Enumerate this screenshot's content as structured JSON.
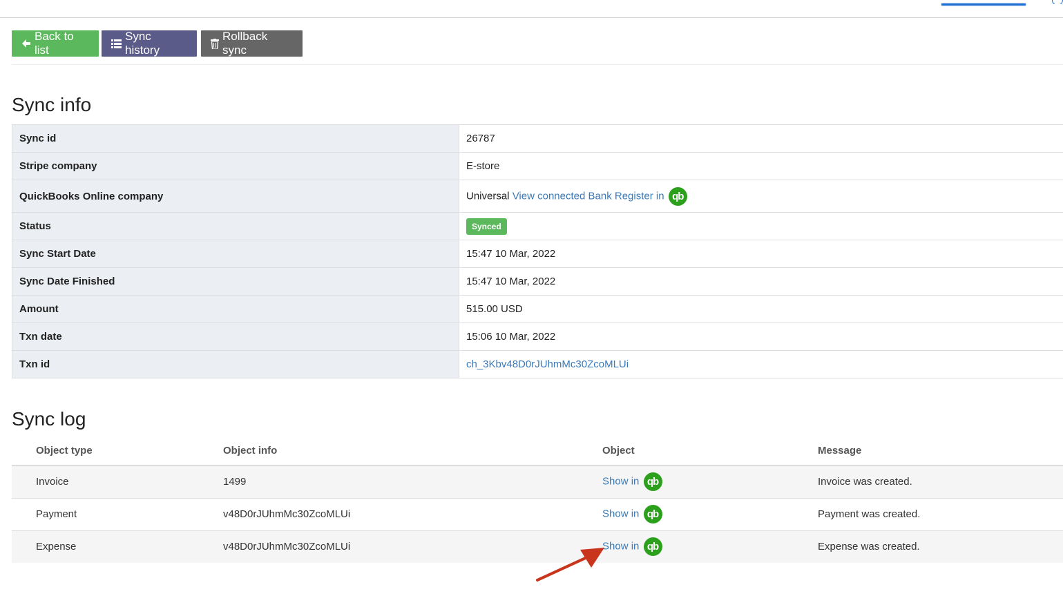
{
  "toolbar": {
    "back_label": "Back to list",
    "history_label": "Sync history",
    "rollback_label": "Rollback sync"
  },
  "sync_info": {
    "heading": "Sync info",
    "rows": [
      {
        "key": "Sync id",
        "value": "26787"
      },
      {
        "key": "Stripe company",
        "value": "E-store"
      },
      {
        "key": "QuickBooks Online company",
        "value": "Universal",
        "link": "View connected Bank Register in"
      },
      {
        "key": "Status",
        "badge": "Synced"
      },
      {
        "key": "Sync Start Date",
        "value": "15:47 10 Mar, 2022"
      },
      {
        "key": "Sync Date Finished",
        "value": "15:47 10 Mar, 2022"
      },
      {
        "key": "Amount",
        "value": "515.00 USD"
      },
      {
        "key": "Txn date",
        "value": "15:06 10 Mar, 2022"
      },
      {
        "key": "Txn id",
        "link": "ch_3Kbv48D0rJUhmMc30ZcoMLUi"
      }
    ]
  },
  "sync_log": {
    "heading": "Sync log",
    "columns": [
      "Object type",
      "Object info",
      "Object",
      "Message"
    ],
    "rows": [
      {
        "type": "Invoice",
        "info": "1499",
        "object": "Show in",
        "message": "Invoice was created."
      },
      {
        "type": "Payment",
        "info": "v48D0rJUhmMc30ZcoMLUi",
        "object": "Show in",
        "message": "Payment was created."
      },
      {
        "type": "Expense",
        "info": "v48D0rJUhmMc30ZcoMLUi",
        "object": "Show in",
        "message": "Expense was created."
      }
    ]
  },
  "qb_logo_text": "qb",
  "colors": {
    "green": "#5cb85c",
    "purple": "#5b5b8a",
    "gray": "#666666",
    "link": "#3a7ab8",
    "qb_green": "#2ca01c",
    "arrow": "#c8351c"
  },
  "icons": {
    "back": "arrow-left-icon",
    "history": "list-icon",
    "rollback": "trash-icon",
    "qb": "quickbooks-logo-icon"
  }
}
